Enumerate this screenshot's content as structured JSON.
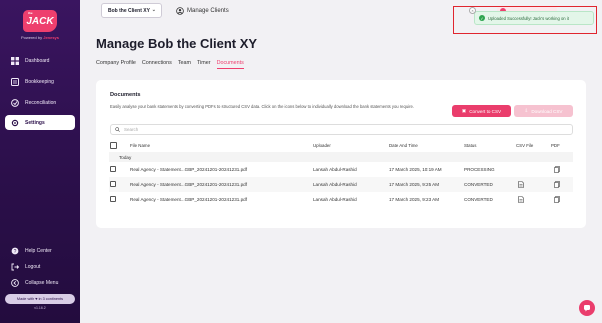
{
  "sidebar": {
    "logo_the": "the",
    "logo_text": "JACK",
    "powered_prefix": "Powered by",
    "powered_brand": "Jenesys",
    "items": [
      {
        "label": "Dashboard",
        "icon": "grid-icon"
      },
      {
        "label": "Bookkeeping",
        "icon": "book-icon"
      },
      {
        "label": "Reconciliation",
        "icon": "reconcile-icon"
      },
      {
        "label": "Settings",
        "icon": "gear-icon",
        "active": true
      }
    ],
    "bottom_items": [
      {
        "label": "Help Center",
        "icon": "help-icon"
      },
      {
        "label": "Logout",
        "icon": "logout-icon"
      },
      {
        "label": "Collapse Menu",
        "icon": "collapse-icon"
      }
    ],
    "made_with": "Made with ♥ in 3 continents",
    "version": "v1.16.2"
  },
  "topbar": {
    "client_select": "Bob the Client XY",
    "manage_clients": "Manage Clients"
  },
  "toast": {
    "message": "Uploaded Successfully! Jack's working on it"
  },
  "page": {
    "title": "Manage Bob the Client XY",
    "tabs": [
      "Company Profile",
      "Connections",
      "Team",
      "Timer",
      "Documents"
    ],
    "active_tab": "Documents"
  },
  "documents": {
    "title": "Documents",
    "description": "Easily analyse your bank statements by converting PDFs to structured CSV data. Click on the icons below to individually download the bank statements you require.",
    "convert_button": "Convert to CSV",
    "download_button": "Download CSV",
    "search_placeholder": "Search",
    "columns": [
      "File Name",
      "Uploader",
      "Date And Time",
      "Status",
      "CSV File",
      "PDF"
    ],
    "group_label": "Today",
    "rows": [
      {
        "file": "Real Agency - Statement...GBP_20241201-20241231.pdf",
        "uploader": "Lansah Abdul-Rashid",
        "datetime": "17 March 2025, 10:19 AM",
        "status": "PROCESSING"
      },
      {
        "file": "Real Agency - Statement...GBP_20241201-20241231.pdf",
        "uploader": "Lansah Abdul-Rashid",
        "datetime": "17 March 2025, 9:25 AM",
        "status": "CONVERTED"
      },
      {
        "file": "Real Agency - Statement...GBP_20241201-20241231.pdf",
        "uploader": "Lansah Abdul-Rashid",
        "datetime": "17 March 2025, 9:23 AM",
        "status": "CONVERTED"
      }
    ]
  },
  "colors": {
    "brand_pink": "#ea3d6c",
    "sidebar_purple": "#2b0f4a",
    "toast_green": "#2ea44f",
    "annotation_red": "#e0262f"
  }
}
